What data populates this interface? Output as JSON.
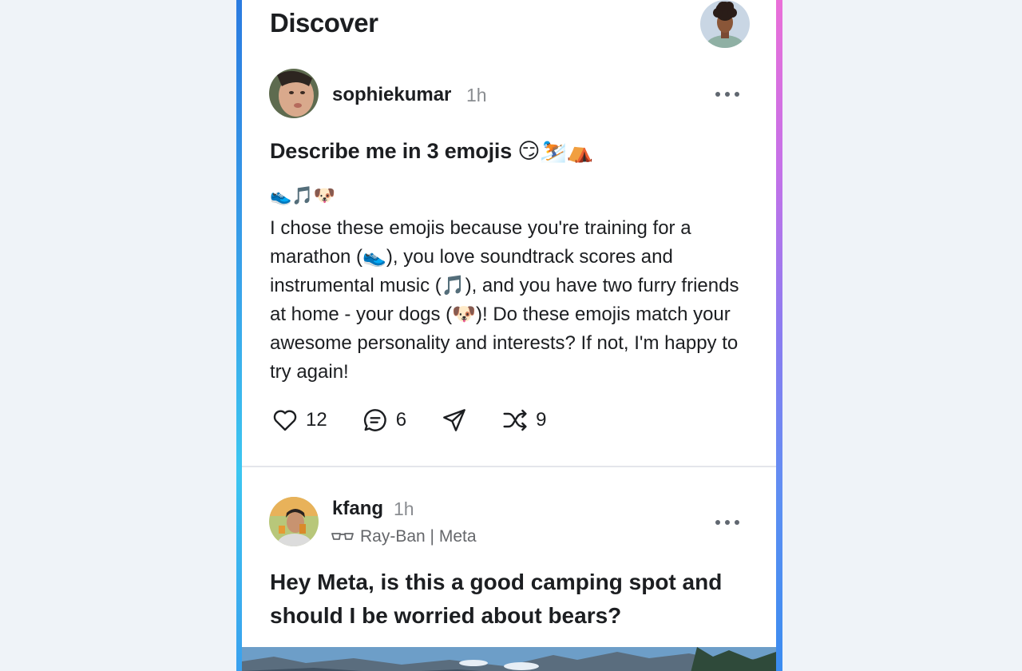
{
  "header": {
    "title": "Discover"
  },
  "posts": [
    {
      "username": "sophiekumar",
      "time": "1h",
      "title": "Describe me in 3 emojis 😏⛷️⛺",
      "emoji_line": "👟🎵🐶",
      "body": "I chose these emojis because you're training for a marathon (👟), you love soundtrack scores and instrumental music (🎵), and you have two furry friends at home - your dogs (🐶)! Do these emojis match your awesome personality and interests? If not, I'm happy to try again!",
      "likes": "12",
      "comments": "6",
      "remixes": "9"
    },
    {
      "username": "kfang",
      "time": "1h",
      "device": "Ray-Ban | Meta",
      "title": "Hey Meta, is this a good camping spot and should I be worried about bears?"
    }
  ],
  "colors": {
    "accent_left": "#2b7be0",
    "accent_right": "#ea6fd8",
    "text": "#1c1e21",
    "muted": "#8a8d91",
    "background": "#eff3f8"
  },
  "icons": [
    "more-icon",
    "heart-icon",
    "comment-icon",
    "share-icon",
    "shuffle-icon",
    "glasses-icon"
  ]
}
